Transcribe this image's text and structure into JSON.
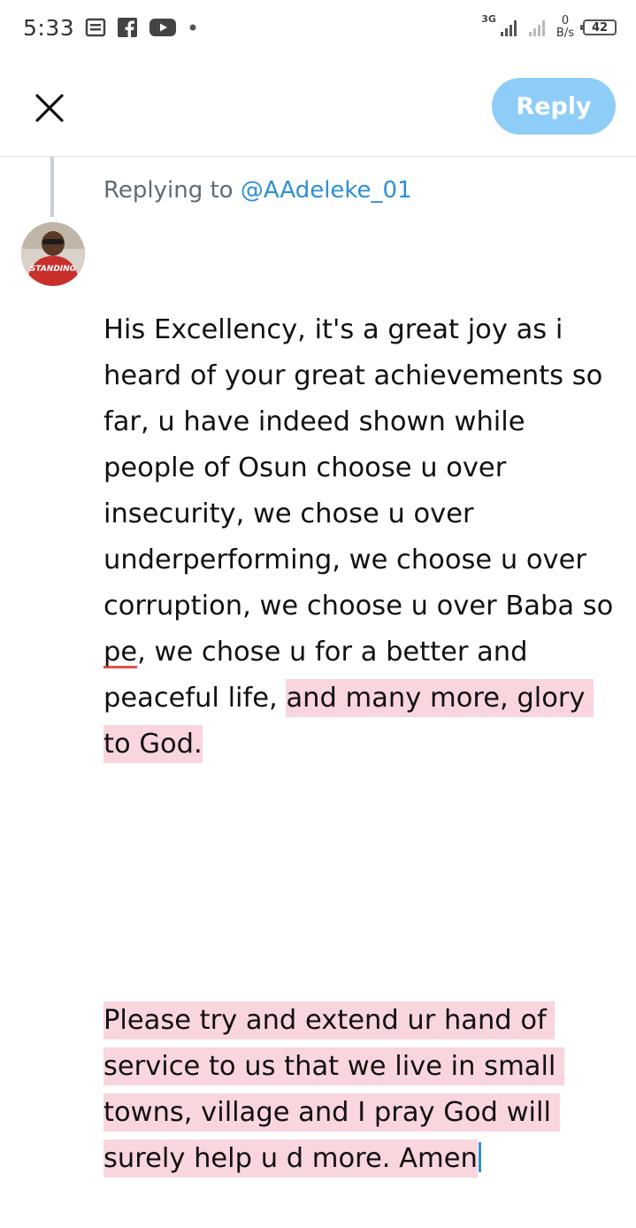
{
  "status_bar": {
    "time": "5:33",
    "network_type": "3G",
    "speed_value": "0",
    "speed_unit": "B/s",
    "battery": "42",
    "icons": [
      "notes-icon",
      "facebook-icon",
      "youtube-icon",
      "dot-icon",
      "signal-icon",
      "signal-icon-2",
      "battery-icon"
    ]
  },
  "header": {
    "close_icon": "close-icon",
    "reply_label": "Reply",
    "reply_color": "#8ecdf7"
  },
  "reply": {
    "prefix": "Replying to ",
    "handle": "@AAdeleke_01"
  },
  "composer": {
    "p1_a": "His Excellency, it's a great joy as i heard of your great achievements so far, u have indeed shown while people of Osun choose u over insecurity, we chose u over underperforming, we choose u over corruption, we choose u over Baba so ",
    "p1_typo": "pe",
    "p1_b": ", we chose u for a better and peaceful life, ",
    "p1_highlight": "and many more, glory to God.",
    "p2_highlight": "Please try and extend ur hand of service to us that we live in small towns, village and I pray God will surely help u d more. Amen",
    "highlight_color": "#f9d5dd"
  }
}
